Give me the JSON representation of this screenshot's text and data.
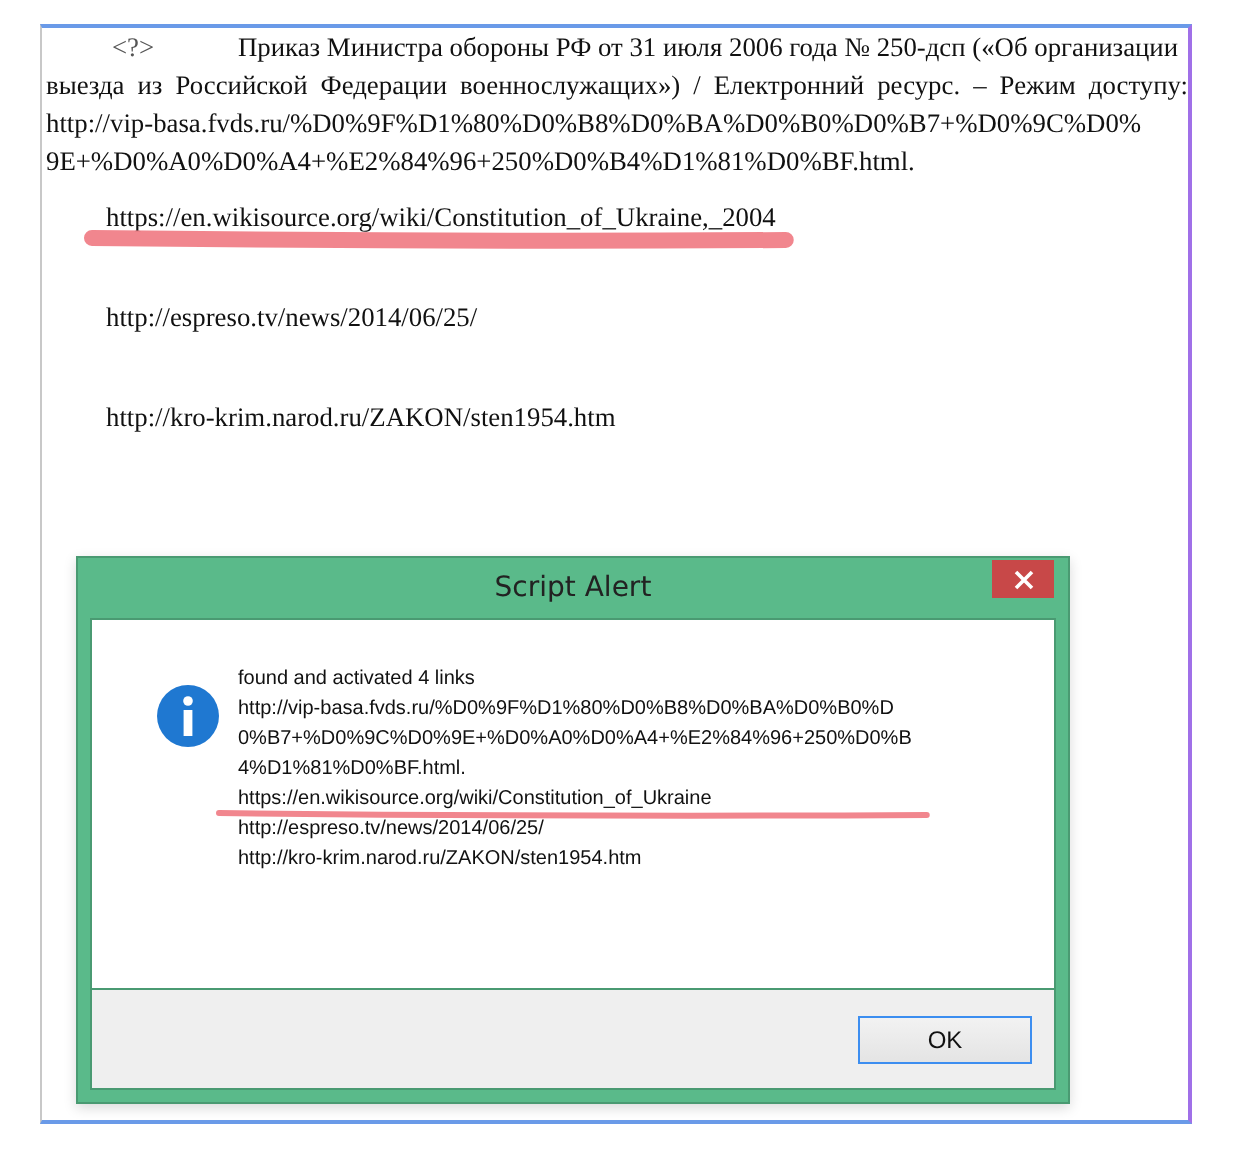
{
  "document": {
    "lines": [
      {
        "kind": "first",
        "marker": "<?>",
        "text": "Приказ Министра обороны РФ от 31 июля 2006 года № 250-дсп («Об организации"
      },
      {
        "kind": "plain",
        "text": "выезда из Российской Федерации военнослужащих») / Електронний ресурс. – Режим доступу:"
      },
      {
        "kind": "plain",
        "text": "http://vip-basa.fvds.ru/%D0%9F%D1%80%D0%B8%D0%BA%D0%B0%D0%B7+%D0%9C%D0%"
      },
      {
        "kind": "plain",
        "text": "9E+%D0%A0%D0%A4+%E2%84%96+250%D0%B4%D1%81%D0%BF.html."
      },
      {
        "kind": "link",
        "text": "https://en.wikisource.org/wiki/Constitution_of_Ukraine,_2004",
        "highlighted": true
      },
      {
        "kind": "link",
        "text": "http://espreso.tv/news/2014/06/25/",
        "highlighted": false
      },
      {
        "kind": "link",
        "text": "http://kro-krim.narod.ru/ZAKON/sten1954.htm",
        "highlighted": false
      }
    ]
  },
  "dialog": {
    "title": "Script Alert",
    "message_lines": [
      {
        "text": "found and activated 4 links",
        "highlighted": false
      },
      {
        "text": "http://vip-basa.fvds.ru/%D0%9F%D1%80%D0%B8%D0%BA%D0%B0%D",
        "highlighted": false
      },
      {
        "text": "0%B7+%D0%9C%D0%9E+%D0%A0%D0%A4+%E2%84%96+250%D0%B",
        "highlighted": false
      },
      {
        "text": "4%D1%81%D0%BF.html.",
        "highlighted": false
      },
      {
        "text": "https://en.wikisource.org/wiki/Constitution_of_Ukraine",
        "highlighted": true
      },
      {
        "text": "http://espreso.tv/news/2014/06/25/",
        "highlighted": false
      },
      {
        "text": "http://kro-krim.narod.ru/ZAKON/sten1954.htm",
        "highlighted": false
      }
    ],
    "buttons": [
      {
        "label": "OK",
        "selected": true
      }
    ]
  }
}
